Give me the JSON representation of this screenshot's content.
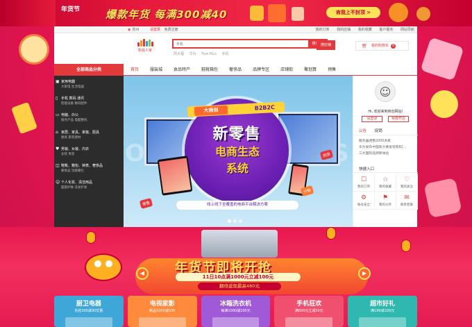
{
  "top_banner": {
    "tag": "年货节",
    "title": "爆款年货 每满300减40",
    "button": "肯我上不封顶 >"
  },
  "topbar": {
    "location": "苏州",
    "greeting": "请登录",
    "register": "免费注册",
    "links": [
      "我的订单",
      "我的店铺",
      "我的收藏",
      "客户服务",
      "网站导航"
    ]
  },
  "logo": {
    "text": "购易人家"
  },
  "search": {
    "placeholder": "手机",
    "button": "搜商品",
    "shop_button": "搜店铺",
    "hotwords": [
      "周大福",
      "华为",
      "Five Plus",
      "手机"
    ]
  },
  "cart": {
    "label": "我的购物车",
    "count": "0"
  },
  "nav": {
    "all_categories": "全部商品分类",
    "items": [
      "首页",
      "服装城",
      "食品特产",
      "鞋靴箱包",
      "奢侈品",
      "品牌专区",
      "店铺街",
      "聚划算",
      "预售"
    ]
  },
  "categories": [
    {
      "icon": "▣",
      "title": "家用电器",
      "sub": "大家电  生活电器"
    },
    {
      "icon": "▯",
      "title": "手机  数码  通讯",
      "sub": "智能设备  数码配件"
    },
    {
      "icon": "▭",
      "title": "电脑、办公",
      "sub": "服务产品  电脑整机"
    },
    {
      "icon": "⌂",
      "title": "家居、家具、家装、厨具",
      "sub": "厨具  家装建材"
    },
    {
      "icon": "♥",
      "title": "男装、女装、内衣",
      "sub": "女装  男装"
    },
    {
      "icon": "◫",
      "title": "鞋靴、箱包、钟表、奢侈品",
      "sub": "奢侈品  功能箱包"
    },
    {
      "icon": "☺",
      "title": "个人化妆、清洁用品",
      "sub": "面部护肤  洗发护发"
    }
  ],
  "hero": {
    "ribbon_left": "大商创",
    "ribbon_right": "B2B2C",
    "headline": "新零售",
    "sub1": "电商生态",
    "sub2": "系统",
    "slogan": "线上线下全覆盖的电商平台解决方案",
    "tag1": "供货",
    "tag2": "零售",
    "tag3": "分销",
    "watermark_left": "O",
    "watermark_right": "S"
  },
  "user": {
    "hello": "Hi, 欢迎来到商创网站!",
    "login": "请登录",
    "register": "我要开店",
    "tabs": [
      "公告",
      "促销"
    ],
    "news": [
      "服务器调整2000多家",
      "华为发布中国高大赛发现有82...",
      "三大国际品牌新体验"
    ],
    "quick_title": "快捷入口",
    "quick": [
      {
        "icon": "☐",
        "label": "我的订单"
      },
      {
        "icon": "☆",
        "label": "我的收藏"
      },
      {
        "icon": "♡",
        "label": "我的关注"
      },
      {
        "icon": "⚙",
        "label": "账号安全"
      },
      {
        "icon": "⚑",
        "label": "我的分享"
      },
      {
        "icon": "✉",
        "label": "联系客服"
      }
    ]
  },
  "festival": {
    "title": "年货节即将开抢",
    "date": "11日10点满1000元立减100元",
    "sub": "翻倍返现最高480元"
  },
  "cards": [
    {
      "name": "厨卫电器",
      "desc": "先抢300减30优惠",
      "color": "#3fa6d8"
    },
    {
      "name": "电视家影",
      "desc": "新品5000减500",
      "color": "#ff8a3c"
    },
    {
      "name": "冰箱洗衣机",
      "desc": "每满1000减100元",
      "color": "#a05ad8"
    },
    {
      "name": "手机狂欢",
      "desc": "满600元立减50元",
      "color": "#f0506e"
    },
    {
      "name": "超市好礼",
      "desc": "满199减100元",
      "color": "#2fb8b0"
    }
  ]
}
